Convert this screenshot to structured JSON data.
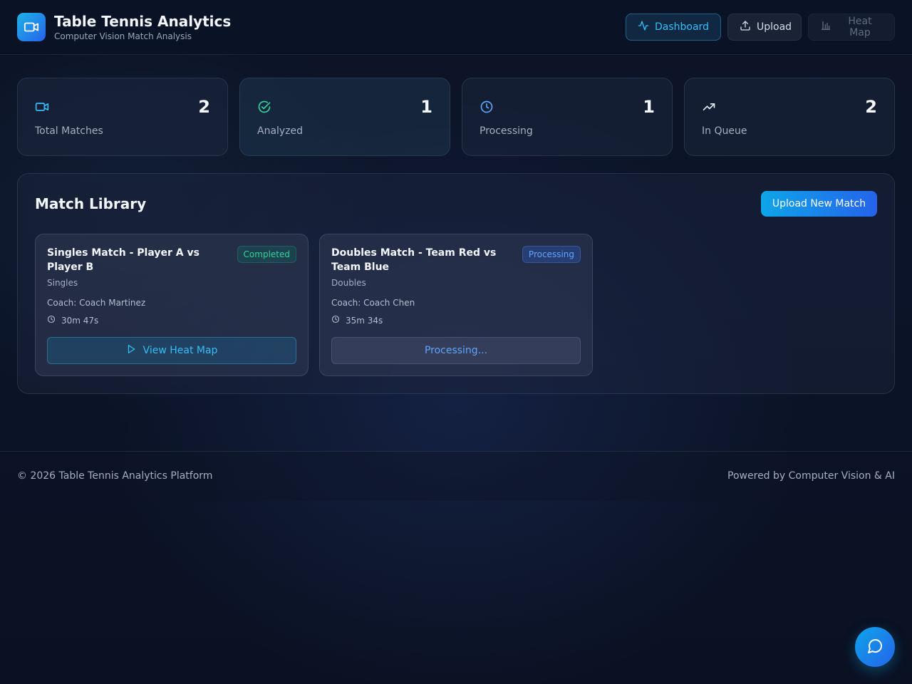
{
  "header": {
    "title": "Table Tennis Analytics",
    "subtitle": "Computer Vision Match Analysis",
    "nav": {
      "dashboard": "Dashboard",
      "upload": "Upload",
      "heatmap": "Heat Map"
    }
  },
  "stats": [
    {
      "value": "2",
      "label": "Total Matches",
      "icon": "video-icon"
    },
    {
      "value": "1",
      "label": "Analyzed",
      "icon": "check-circle-icon"
    },
    {
      "value": "1",
      "label": "Processing",
      "icon": "clock-icon"
    },
    {
      "value": "2",
      "label": "In Queue",
      "icon": "trending-up-icon"
    }
  ],
  "library": {
    "title": "Match Library",
    "upload_label": "Upload New Match",
    "matches": [
      {
        "title": "Singles Match - Player A vs Player B",
        "status": "Completed",
        "type": "Singles",
        "coach": "Coach: Coach Martinez",
        "duration": "30m 47s",
        "action": "View Heat Map"
      },
      {
        "title": "Doubles Match - Team Red vs Team Blue",
        "status": "Processing",
        "type": "Doubles",
        "coach": "Coach: Coach Chen",
        "duration": "35m 34s",
        "action": "Processing..."
      }
    ]
  },
  "footer": {
    "left": "© 2026 Table Tennis Analytics Platform",
    "right": "Powered by Computer Vision & AI"
  },
  "colors": {
    "accent": "#38bdf8",
    "brand_gradient_start": "#0ea5e9",
    "brand_gradient_end": "#2563eb",
    "success": "#34d399",
    "processing": "#60a5fa"
  }
}
